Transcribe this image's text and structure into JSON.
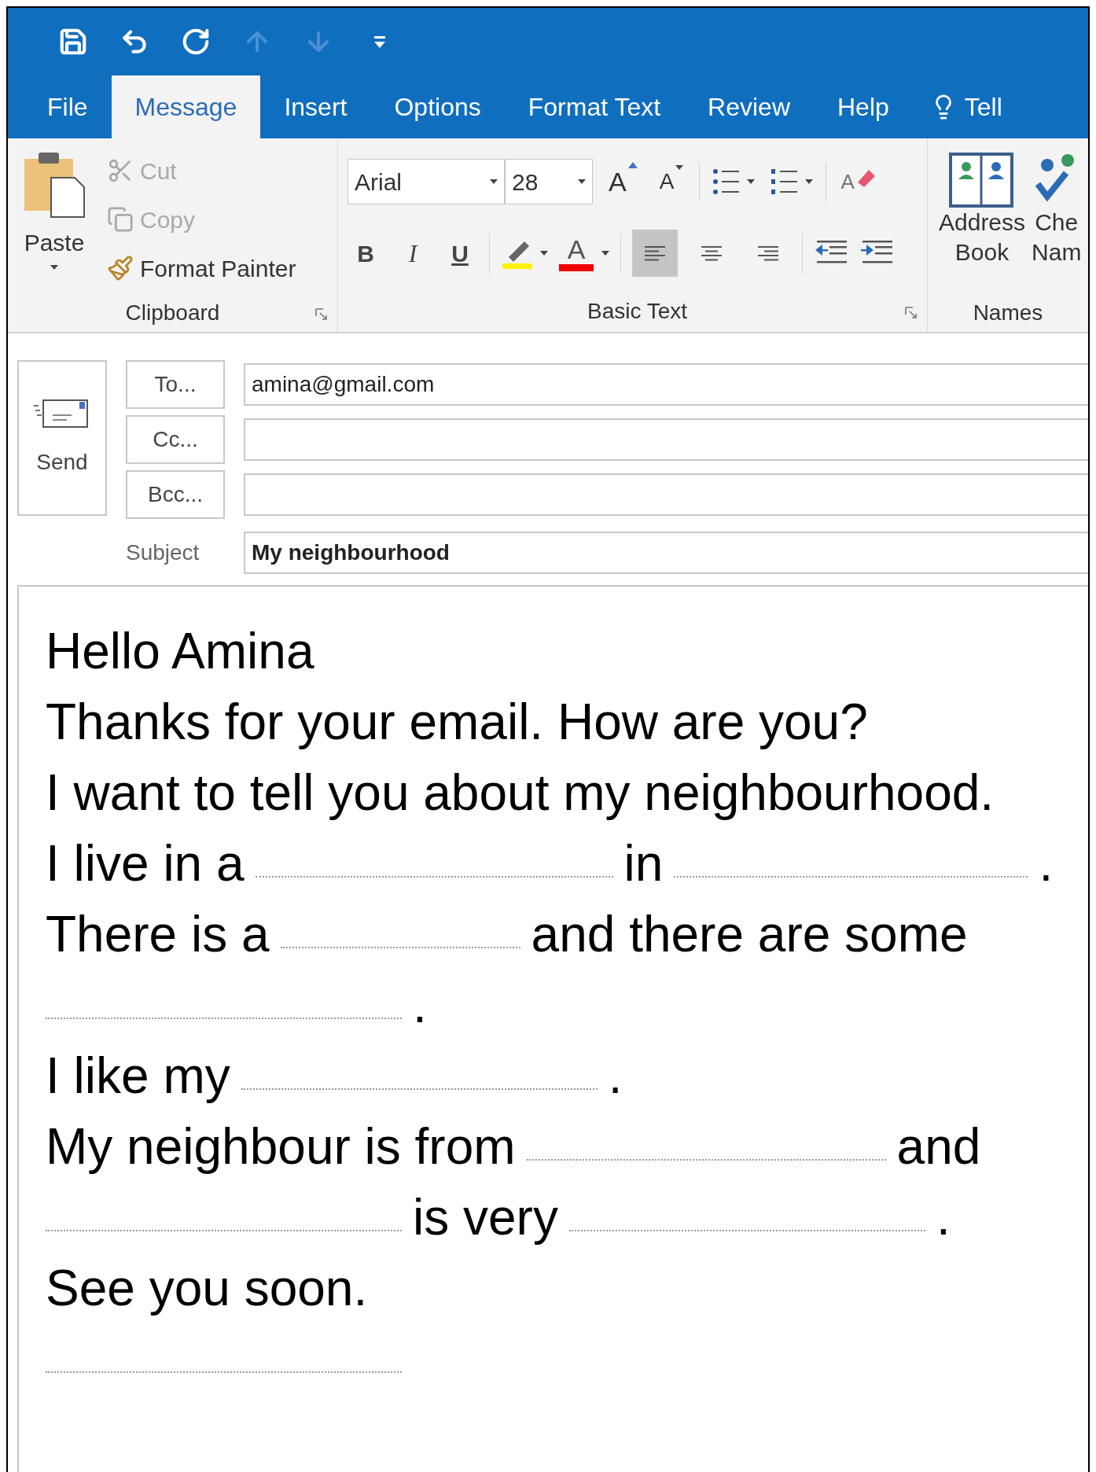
{
  "quick_access": [
    {
      "kind": "save",
      "disabled": false
    },
    {
      "kind": "undo",
      "disabled": false
    },
    {
      "kind": "redo",
      "disabled": false
    },
    {
      "kind": "up",
      "disabled": true
    },
    {
      "kind": "down",
      "disabled": true
    },
    {
      "kind": "customize",
      "disabled": false
    }
  ],
  "tabs": [
    {
      "label": "File",
      "selected": false
    },
    {
      "label": "Message",
      "selected": true
    },
    {
      "label": "Insert",
      "selected": false
    },
    {
      "label": "Options",
      "selected": false
    },
    {
      "label": "Format Text",
      "selected": false
    },
    {
      "label": "Review",
      "selected": false
    },
    {
      "label": "Help",
      "selected": false
    }
  ],
  "tell_me": {
    "label": "Tell"
  },
  "clipboard": {
    "paste": "Paste",
    "items": [
      {
        "kind": "cut",
        "label": "Cut",
        "disabled": true
      },
      {
        "kind": "copy",
        "label": "Copy",
        "disabled": true
      },
      {
        "kind": "painter",
        "label": "Format Painter",
        "disabled": false
      }
    ],
    "group_label": "Clipboard"
  },
  "basic_text": {
    "font": "Arial",
    "size": "28",
    "grow": "A",
    "shrink": "A",
    "clear": "A",
    "bold": "B",
    "italic": "I",
    "underline": "U",
    "font_color": "A",
    "alignments": [
      {
        "kind": "left",
        "selected": true
      },
      {
        "kind": "center",
        "selected": false
      },
      {
        "kind": "right",
        "selected": false
      }
    ],
    "group_label": "Basic Text"
  },
  "names": {
    "buttons": [
      {
        "kind": "address_book",
        "lines": [
          "Address",
          "Book"
        ]
      },
      {
        "kind": "check_names",
        "lines": [
          "Che",
          "Nam"
        ]
      }
    ],
    "group_label": "Names"
  },
  "compose": {
    "send": "Send",
    "recipients": [
      {
        "button": "To...",
        "value": "amina@gmail.com"
      },
      {
        "button": "Cc..."
      },
      {
        "button": "Bcc..."
      }
    ],
    "subject_label": "Subject",
    "subject": "My neighbourhood"
  },
  "body": [
    [
      {
        "kind": "text",
        "text": "Hello Amina"
      }
    ],
    [
      {
        "kind": "text",
        "text": "Thanks for your email. How are you?"
      }
    ],
    [
      {
        "kind": "text",
        "text": "I want to tell you about my neighbourhood."
      }
    ],
    [
      {
        "kind": "text",
        "text": "I live in a"
      },
      {
        "kind": "blank"
      },
      {
        "kind": "text",
        "text": "in"
      },
      {
        "kind": "blank"
      },
      {
        "kind": "text",
        "text": "."
      }
    ],
    [
      {
        "kind": "text",
        "text": "There is a"
      },
      {
        "kind": "blank"
      },
      {
        "kind": "text",
        "text": "and there are some"
      }
    ],
    [
      {
        "kind": "blank"
      },
      {
        "kind": "text",
        "text": "."
      }
    ],
    [
      {
        "kind": "text",
        "text": "I like my"
      },
      {
        "kind": "blank"
      },
      {
        "kind": "text",
        "text": "."
      }
    ],
    [
      {
        "kind": "text",
        "text": "My neighbour is from"
      },
      {
        "kind": "blank"
      },
      {
        "kind": "text",
        "text": "and"
      }
    ],
    [
      {
        "kind": "blank"
      },
      {
        "kind": "text",
        "text": "is very"
      },
      {
        "kind": "blank"
      },
      {
        "kind": "text",
        "text": "."
      }
    ],
    [
      {
        "kind": "text",
        "text": "See you soon."
      }
    ],
    [
      {
        "kind": "blank"
      }
    ]
  ]
}
